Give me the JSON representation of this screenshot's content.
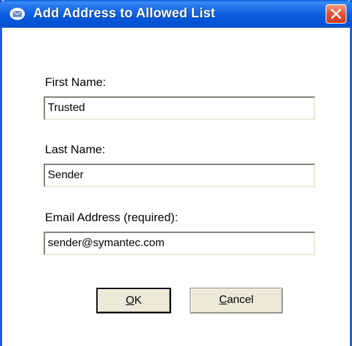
{
  "window": {
    "title": "Add Address to Allowed List",
    "app_icon": "mail-envelope-icon",
    "close_icon": "close-icon"
  },
  "form": {
    "first_name_label": "First Name:",
    "first_name_value": "Trusted",
    "last_name_label": "Last Name:",
    "last_name_value": "Sender",
    "email_label": "Email Address (required):",
    "email_value": "sender@symantec.com"
  },
  "buttons": {
    "ok_mnemonic": "O",
    "ok_rest": "K",
    "cancel_mnemonic": "C",
    "cancel_rest": "ancel"
  },
  "colors": {
    "title_bar": "#0a5ede",
    "window_border": "#1f58e0",
    "close_button": "#e2583a",
    "button_face": "#ece9d8"
  }
}
